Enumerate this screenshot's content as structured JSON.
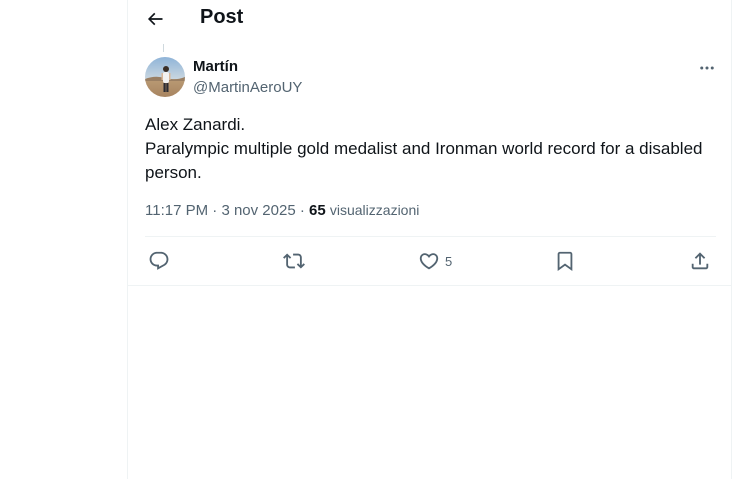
{
  "header": {
    "title": "Post",
    "back_icon": "arrow-left-icon"
  },
  "tweet": {
    "author": {
      "display_name": "Martín",
      "handle": "@MartinAeroUY"
    },
    "text_lines": [
      "Alex Zanardi.",
      "Paralympic multiple gold medalist and Ironman world record for a disabled person."
    ],
    "time": "11:17 PM",
    "separator": "·",
    "date": "3 nov 2025",
    "views_count": "65",
    "views_label": "visualizzazioni",
    "actions": {
      "reply_icon": "reply-icon",
      "repost_icon": "repost-icon",
      "like_icon": "heart-icon",
      "like_count": "5",
      "bookmark_icon": "bookmark-icon",
      "share_icon": "share-icon"
    }
  },
  "colors": {
    "text_primary": "#0f1419",
    "text_secondary": "#536471",
    "border": "#eff3f4"
  }
}
